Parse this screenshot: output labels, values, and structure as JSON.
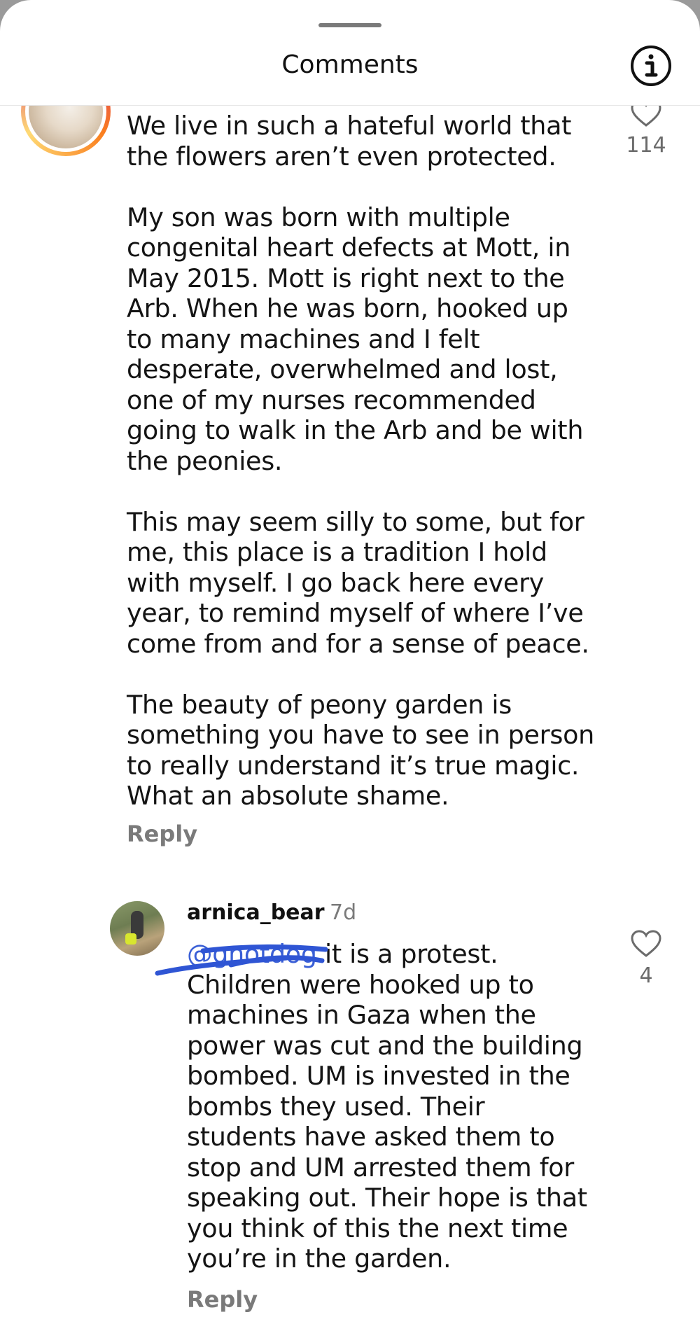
{
  "header": {
    "title": "Comments"
  },
  "comments": [
    {
      "text": "We live in such a hateful world that\nthe flowers aren’t even protected.\n\nMy son was born with multiple\ncongenital heart defects at Mott, in\nMay 2015. Mott is right next to the\nArb. When he was born, hooked up\nto many machines and I felt\ndesperate, overwhelmed and lost,\none of my nurses recommended\ngoing to walk in the Arb and be with\nthe peonies.\n\nThis may seem silly to some, but for\nme, this place is a tradition I hold\nwith myself. I go back here every\nyear, to remind myself of where I’ve\ncome from and for a sense of peace.\n\nThe beauty of peony garden is\nsomething you have to see in person\nto really understand it’s true magic.\nWhat an absolute shame.",
      "likes": "114",
      "reply_label": "Reply"
    },
    {
      "username": "arnica_bear",
      "time": "7d",
      "mention": "@gnotdog",
      "text": " it is a protest.\nChildren were hooked up to\nmachines in Gaza when the\npower was cut and the building\nbombed. UM is invested in the\nbombs they used. Their\nstudents  have asked them to\nstop and UM arrested them for\nspeaking out. Their hope is that\nyou think of this the next time\nyou’re in the garden.",
      "likes": "4",
      "reply_label": "Reply"
    }
  ],
  "colors": {
    "link": "#3a5fd6",
    "scribble": "#2f55d4",
    "muted": "#7a7a7a"
  }
}
